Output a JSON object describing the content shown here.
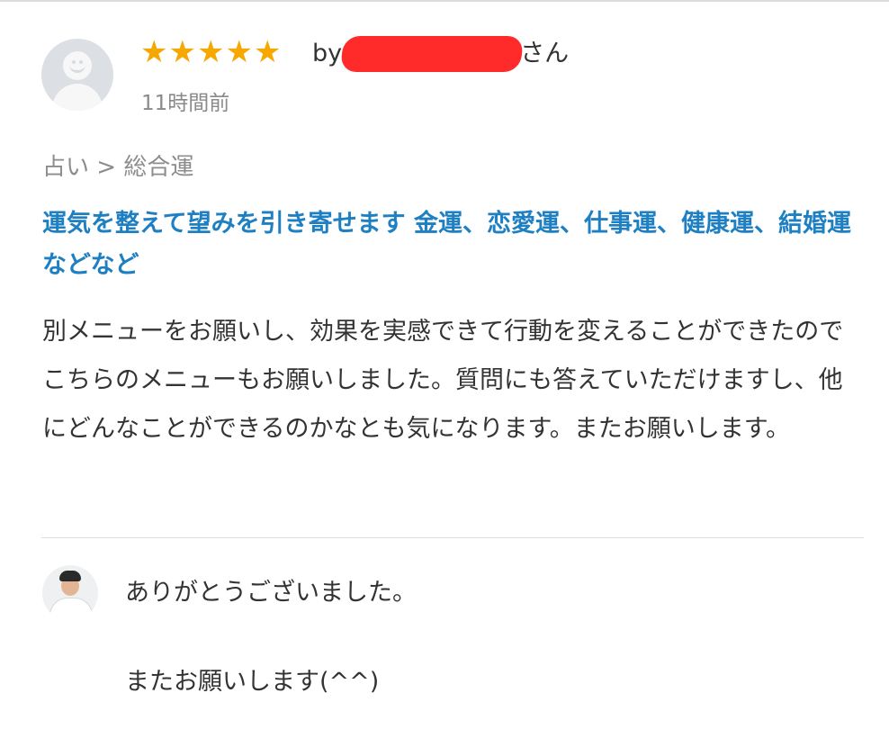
{
  "review": {
    "rating": 5,
    "stars": [
      "★",
      "★",
      "★",
      "★",
      "★"
    ],
    "by_prefix": "by",
    "by_suffix": "さん",
    "time": "11時間前",
    "breadcrumb": "占い > 総合運",
    "title": "運気を整えて望みを引き寄せます 金運、恋愛運、仕事運、健康運、結婚運などなど",
    "body": "別メニューをお願いし、効果を実感できて行動を変えることができたのでこちらのメニューもお願いしました。質問にも答えていただけますし、他にどんなことができるのかなとも気になります。またお願いします。"
  },
  "reply": {
    "line1": "ありがとうございました。",
    "line2": "またお願いします(^^)"
  },
  "colors": {
    "star": "#f6a700",
    "title": "#1e7fc2",
    "redaction": "#ff2a2a"
  },
  "icons": {
    "reviewer_avatar": "default-user-avatar-icon",
    "seller_avatar": "seller-photo-avatar"
  }
}
